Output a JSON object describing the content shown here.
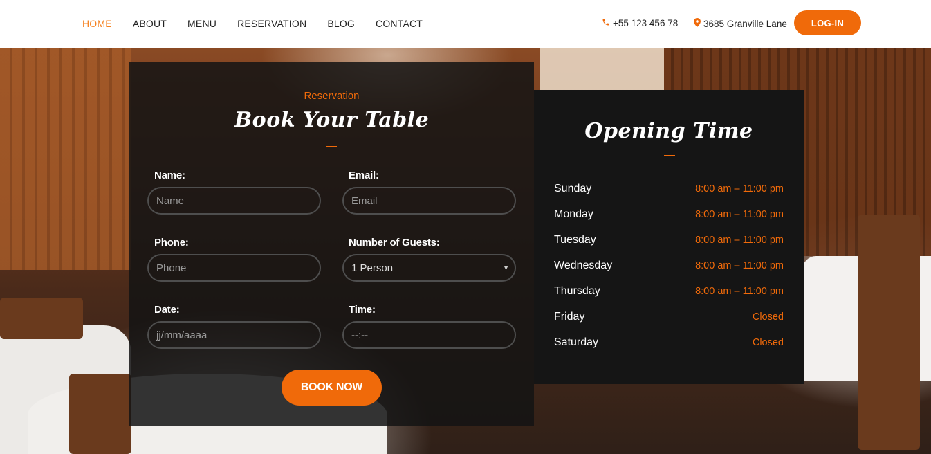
{
  "nav": {
    "items": [
      {
        "label": "HOME",
        "active": true
      },
      {
        "label": "ABOUT",
        "active": false
      },
      {
        "label": "MENU",
        "active": false
      },
      {
        "label": "RESERVATION",
        "active": false
      },
      {
        "label": "BLOG",
        "active": false
      },
      {
        "label": "CONTACT",
        "active": false
      }
    ]
  },
  "header": {
    "phone": "+55 123 456 78",
    "address": "3685 Granville Lane",
    "login_label": "LOG-IN",
    "phone_icon": "phone-icon",
    "location_icon": "map-marker-icon"
  },
  "booking": {
    "eyebrow": "Reservation",
    "title": "Book Your Table",
    "name_label": "Name:",
    "name_placeholder": "Name",
    "email_label": "Email:",
    "email_placeholder": "Email",
    "phone_label": "Phone:",
    "phone_placeholder": "Phone",
    "guests_label": "Number of Guests:",
    "guests_value": "1 Person",
    "date_label": "Date:",
    "date_placeholder": "jj/mm/aaaa",
    "time_label": "Time:",
    "time_placeholder": "--:--",
    "submit_label": "BOOK NOW"
  },
  "hours": {
    "title": "Opening Time",
    "rows": [
      {
        "day": "Sunday",
        "time": "8:00 am – 11:00 pm"
      },
      {
        "day": "Monday",
        "time": "8:00 am – 11:00 pm"
      },
      {
        "day": "Tuesday",
        "time": "8:00 am – 11:00 pm"
      },
      {
        "day": "Wednesday",
        "time": "8:00 am – 11:00 pm"
      },
      {
        "day": "Thursday",
        "time": "8:00 am – 11:00 pm"
      },
      {
        "day": "Friday",
        "time": "Closed"
      },
      {
        "day": "Saturday",
        "time": "Closed"
      }
    ]
  },
  "colors": {
    "accent": "#f06a0a",
    "panel": "#151515",
    "header_bg": "#ffffff"
  }
}
